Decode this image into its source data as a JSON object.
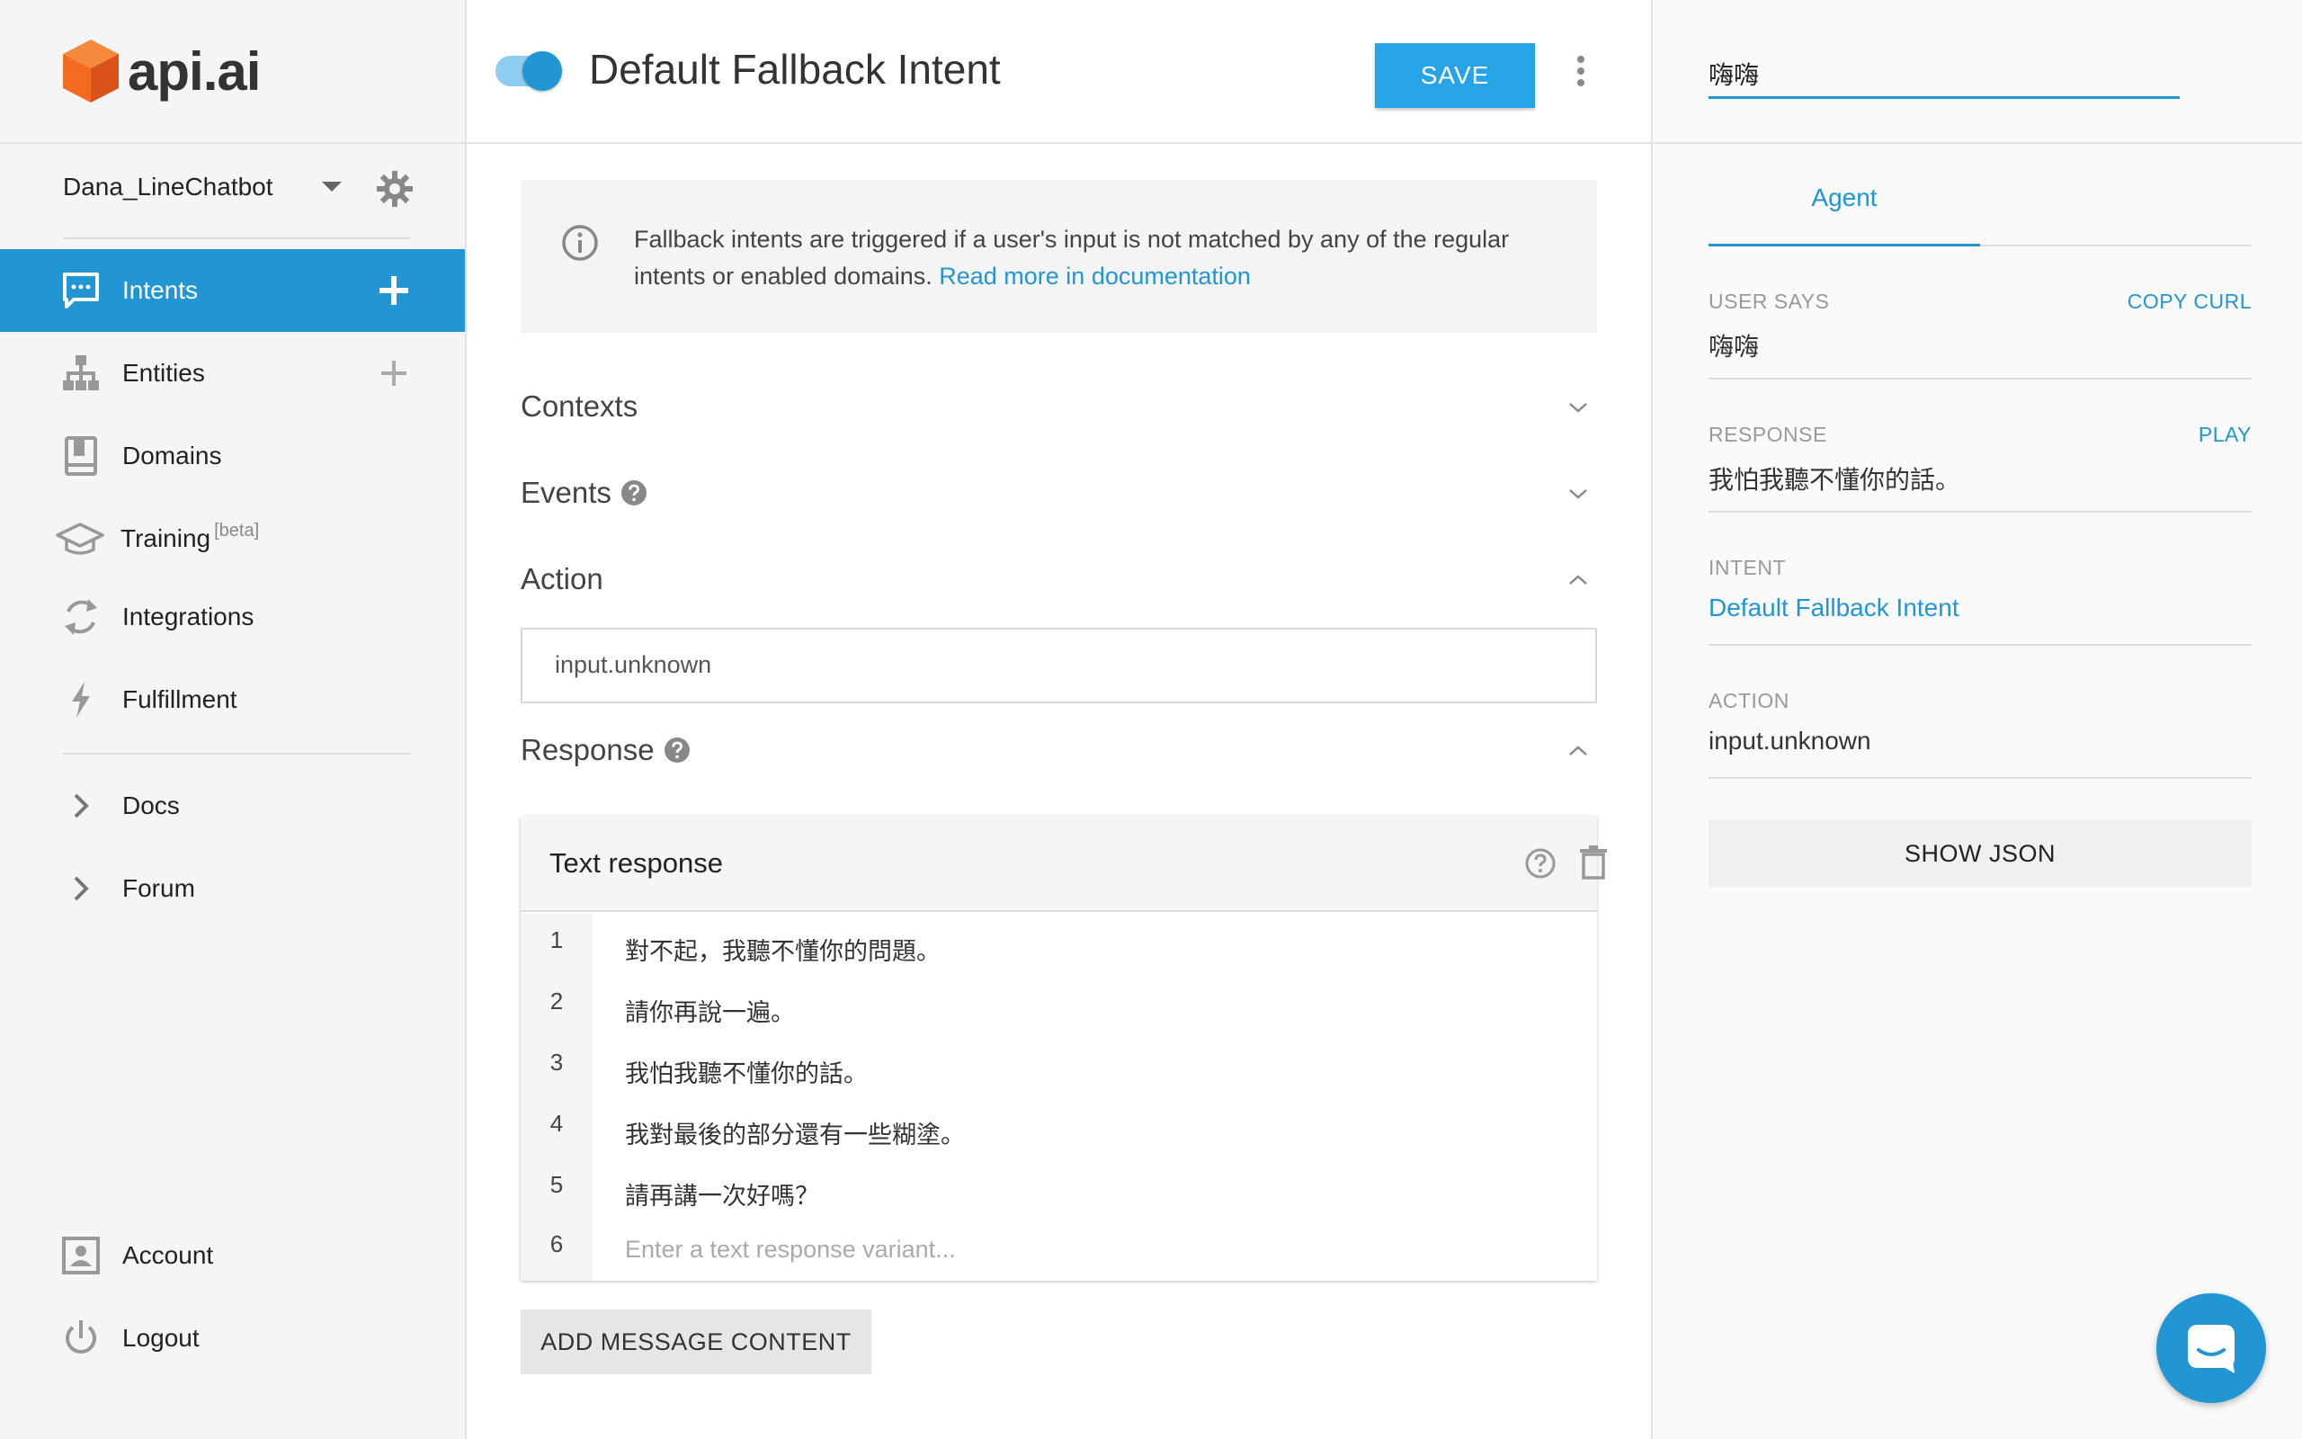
{
  "brand": {
    "logo_text": "api.ai",
    "accent": "#2196d3",
    "logo_color": "#f26b21"
  },
  "sidebar": {
    "agent_name": "Dana_LineChatbot",
    "items": [
      {
        "label": "Intents",
        "icon": "chat-icon",
        "active": true
      },
      {
        "label": "Entities",
        "icon": "hierarchy-icon"
      },
      {
        "label": "Domains",
        "icon": "book-icon"
      },
      {
        "label": "Training",
        "badge": "[beta]",
        "icon": "graduation-cap-icon"
      },
      {
        "label": "Integrations",
        "icon": "refresh-icon"
      },
      {
        "label": "Fulfillment",
        "icon": "lightning-icon"
      },
      {
        "label": "Docs",
        "icon": "chevron-right-icon"
      },
      {
        "label": "Forum",
        "icon": "chevron-right-icon"
      },
      {
        "label": "Account",
        "icon": "account-icon"
      },
      {
        "label": "Logout",
        "icon": "power-icon"
      }
    ]
  },
  "header": {
    "intent_title": "Default Fallback Intent",
    "save_label": "SAVE",
    "toggle_on": true
  },
  "info": {
    "text": "Fallback intents are triggered if a user's input is not matched by any of the regular intents or enabled domains.",
    "link": "Read more in documentation"
  },
  "sections": {
    "contexts": "Contexts",
    "events": "Events",
    "action": "Action",
    "response": "Response"
  },
  "action_value": "input.unknown",
  "text_response": {
    "title": "Text response",
    "rows": [
      {
        "num": "1",
        "text": "對不起，我聽不懂你的問題。"
      },
      {
        "num": "2",
        "text": "請你再說一遍。"
      },
      {
        "num": "3",
        "text": "我怕我聽不懂你的話。"
      },
      {
        "num": "4",
        "text": "我對最後的部分還有一些糊塗。"
      },
      {
        "num": "5",
        "text": "請再講一次好嗎？"
      },
      {
        "num": "6",
        "placeholder": "Enter a text response variant..."
      }
    ]
  },
  "add_message_label": "ADD MESSAGE CONTENT",
  "try_it": {
    "query": "嗨嗨",
    "tab": "Agent",
    "user_says_label": "USER SAYS",
    "copy_curl": "COPY CURL",
    "user_says": "嗨嗨",
    "response_label": "RESPONSE",
    "play": "PLAY",
    "response": "我怕我聽不懂你的話。",
    "intent_label": "INTENT",
    "intent": "Default Fallback Intent",
    "action_label": "ACTION",
    "action": "input.unknown",
    "show_json": "SHOW JSON"
  }
}
